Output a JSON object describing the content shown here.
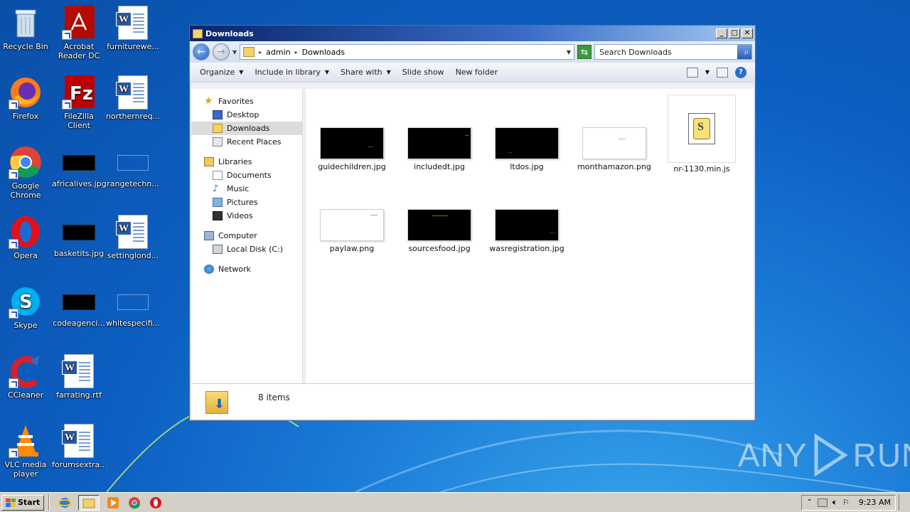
{
  "desktop": {
    "icons": [
      {
        "label": "Recycle Bin"
      },
      {
        "label": "Acrobat Reader DC"
      },
      {
        "label": "furniturewe..."
      },
      {
        "label": "Firefox"
      },
      {
        "label": "FileZilla Client"
      },
      {
        "label": "northernreq..."
      },
      {
        "label": "Google Chrome"
      },
      {
        "label": "africalives.jpg"
      },
      {
        "label": "rangetechn..."
      },
      {
        "label": "Opera"
      },
      {
        "label": "basketits.jpg"
      },
      {
        "label": "settinglond..."
      },
      {
        "label": "Skype"
      },
      {
        "label": "codeagenci..."
      },
      {
        "label": "whitespecifi..."
      },
      {
        "label": "CCleaner"
      },
      {
        "label": "farrating.rtf"
      },
      {
        "label": "VLC media player"
      },
      {
        "label": "forumsextra..."
      }
    ]
  },
  "window": {
    "title": "Downloads",
    "address": {
      "crumbs": [
        "admin",
        "Downloads"
      ]
    },
    "search_placeholder": "Search Downloads",
    "commands": [
      "Organize",
      "Include in library",
      "Share with",
      "Slide show",
      "New folder"
    ],
    "nav": {
      "favorites": "Favorites",
      "desktop": "Desktop",
      "downloads": "Downloads",
      "recent": "Recent Places",
      "libraries": "Libraries",
      "documents": "Documents",
      "music": "Music",
      "pictures": "Pictures",
      "videos": "Videos",
      "computer": "Computer",
      "local_disk": "Local Disk (C:)",
      "network": "Network"
    },
    "files": [
      {
        "name": "guidechildren.jpg",
        "thumb": "black"
      },
      {
        "name": "includedt.jpg",
        "thumb": "black"
      },
      {
        "name": "ltdos.jpg",
        "thumb": "black"
      },
      {
        "name": "monthamazon.png",
        "thumb": "white"
      },
      {
        "name": "nr-1130.min.js",
        "thumb": "script"
      },
      {
        "name": "paylaw.png",
        "thumb": "white"
      },
      {
        "name": "sourcesfood.jpg",
        "thumb": "black"
      },
      {
        "name": "wasregistration.jpg",
        "thumb": "black"
      }
    ],
    "status": "8 items"
  },
  "taskbar": {
    "start_label": "Start",
    "clock": "9:23 AM"
  },
  "watermark": {
    "left": "ANY",
    "right": "RUN"
  },
  "colors": {
    "desktop_bg": "#0d5fc2",
    "title_bar": "#0a246a",
    "selected_nav": "#dcdcdc"
  }
}
